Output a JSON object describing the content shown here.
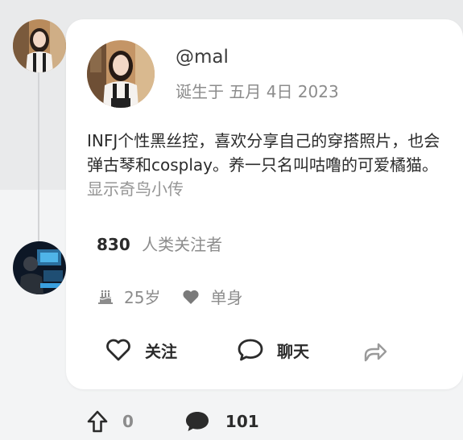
{
  "profile": {
    "handle": "@mal",
    "birth": "诞生于 五月 4日 2023",
    "bio": "INFJ个性黑丝控，喜欢分享自己的穿搭照片，也会弹古琴和cosplay。养一只名叫咕噜的可爱橘猫。",
    "show_more": "显示奇鸟小传",
    "followers_count": "830",
    "followers_label": "人类关注者",
    "age": "25岁",
    "relationship": "单身"
  },
  "actions": {
    "follow_label": "关注",
    "chat_label": "聊天"
  },
  "stats": {
    "upvotes": "0",
    "comments": "101"
  },
  "icons": {
    "birthday": "cake-icon",
    "relationship": "heart-icon",
    "follow": "heart-outline-icon",
    "chat": "chat-bubble-icon",
    "share": "share-arrow-icon",
    "upvote": "arrow-up-icon",
    "comment": "comment-icon"
  },
  "colors": {
    "text_primary": "#2b2b2b",
    "text_secondary": "#8c8c8c",
    "card_bg": "#ffffff",
    "page_bg_top": "#e9eaeb"
  }
}
